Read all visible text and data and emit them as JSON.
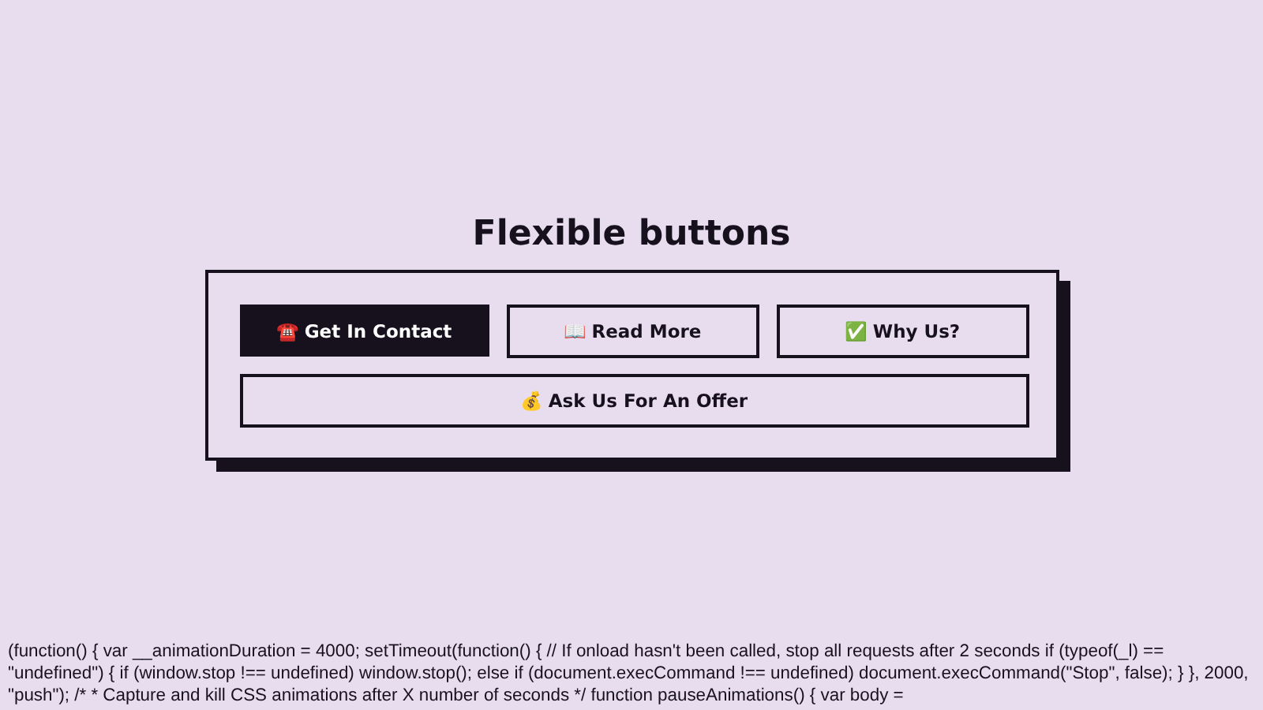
{
  "title": "Flexible buttons",
  "buttons": [
    {
      "icon": "☎️",
      "label": "Get In Contact",
      "selected": true
    },
    {
      "icon": "📖",
      "label": "Read More",
      "selected": false
    },
    {
      "icon": "✅",
      "label": "Why Us?",
      "selected": false
    },
    {
      "icon": "💰",
      "label": "Ask Us For An Offer",
      "selected": false
    }
  ],
  "script_text": "(function() { var __animationDuration = 4000; setTimeout(function() { // If onload hasn't been called, stop all requests after 2 seconds if (typeof(_l) == \"undefined\") { if (window.stop !== undefined) window.stop(); else if (document.execCommand !== undefined) document.execCommand(\"Stop\", false); } }, 2000, \"push\"); /* * Capture and kill CSS animations after X number of seconds */ function pauseAnimations() { var body ="
}
